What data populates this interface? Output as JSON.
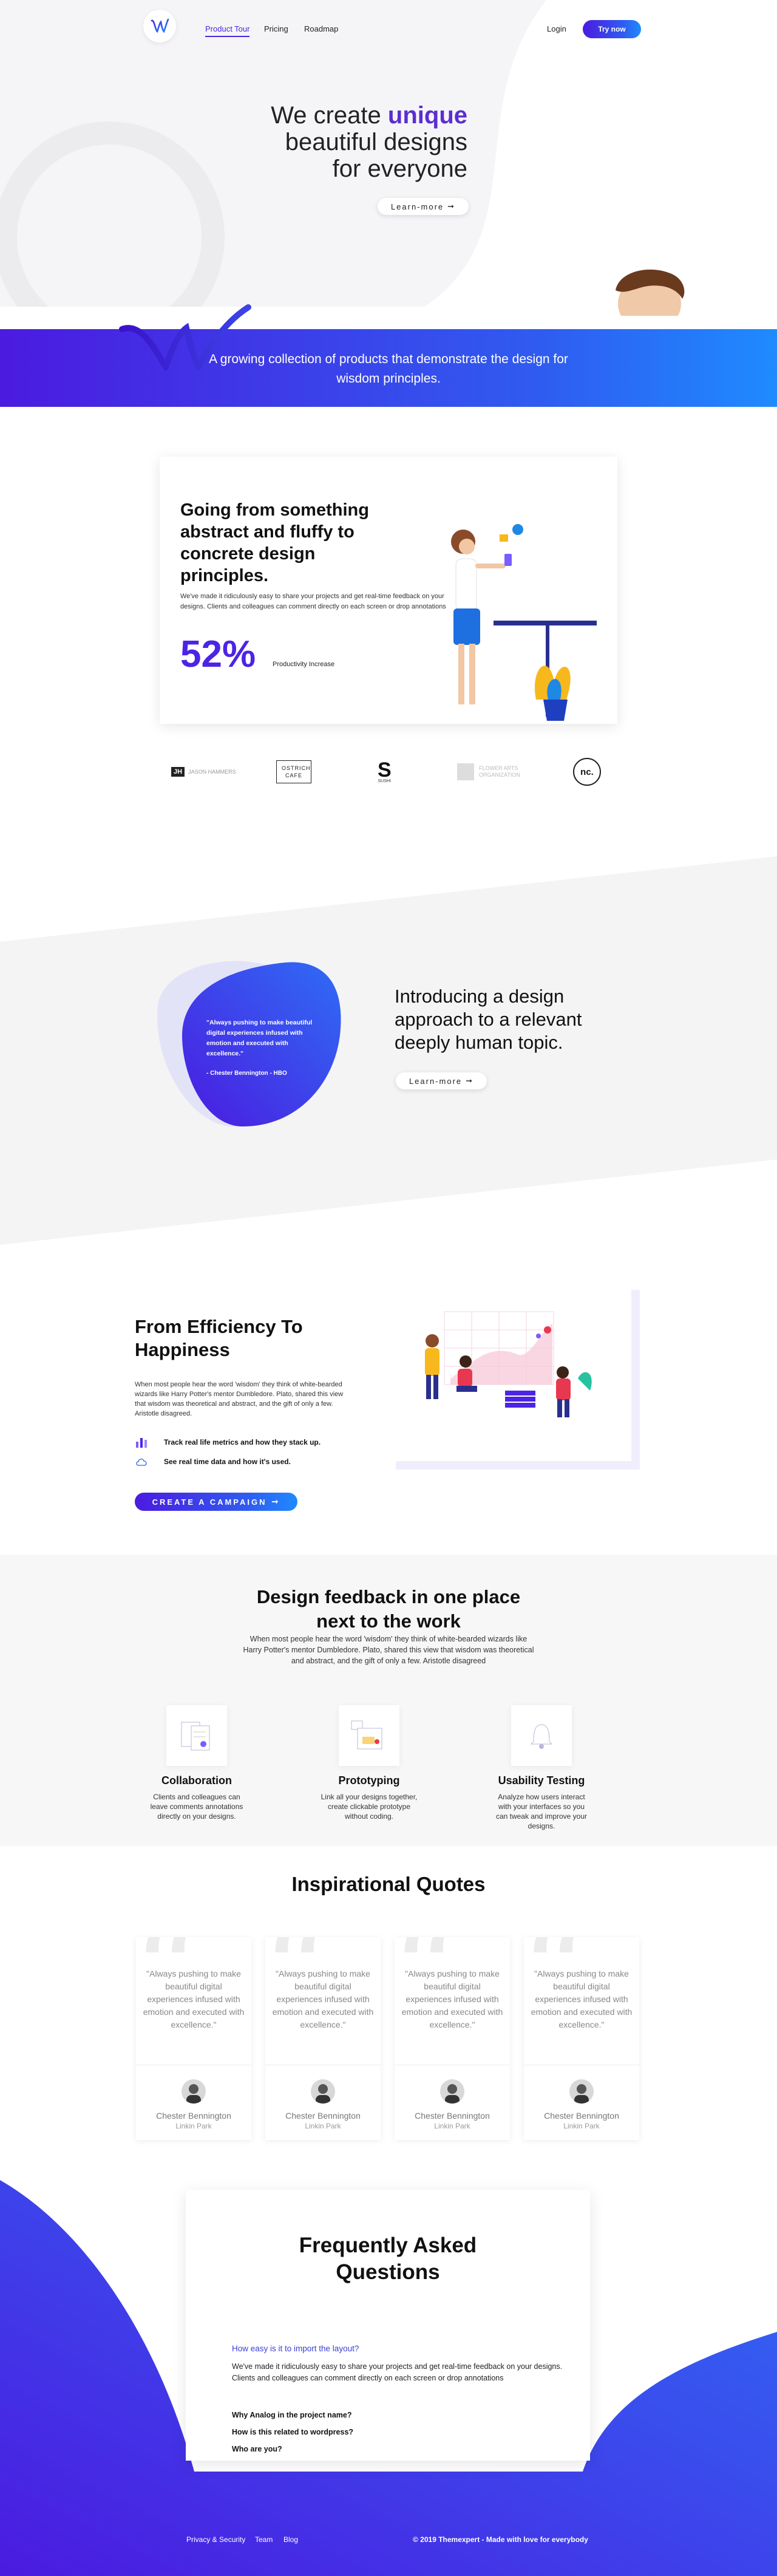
{
  "header": {
    "nav": [
      {
        "label": "Product Tour"
      },
      {
        "label": "Pricing"
      },
      {
        "label": "Roadmap"
      }
    ],
    "login": "Login",
    "cta": "Try now"
  },
  "hero": {
    "line1a": "We create",
    "line1b": "unique",
    "line2": "beautiful designs",
    "line3": "for everyone",
    "button": "Learn-more"
  },
  "banner": {
    "text": "A growing collection of products that demonstrate the design for wisdom principles."
  },
  "card1": {
    "title": "Going from something abstract and fluffy to concrete design principles.",
    "body": "We've made it ridiculously easy to share your projects and get real-time feedback on your designs. Clients and colleagues can comment directly on each screen or drop annotations",
    "stat": "52%",
    "stat_label": "Productivity Increase"
  },
  "logos": [
    {
      "text": "JASON HAMMERS"
    },
    {
      "text": "OSTRICH CAFE"
    },
    {
      "text": "SUSHI"
    },
    {
      "text": "FLOWER ARTS ORGANIZATION"
    },
    {
      "text": "nc."
    }
  ],
  "intro": {
    "quote": "\"Always pushing to make beautiful digital experiences infused with emotion and executed with excellence.\"",
    "author": "- Chester Bennington - HBO",
    "title": "Introducing a design approach to a relevant deeply human topic.",
    "button": "Learn-more"
  },
  "efficiency": {
    "title": "From Efficiency To Happiness",
    "body": "When most people hear the word 'wisdom' they think of white-bearded wizards like Harry Potter's mentor Dumbledore. Plato, shared this view that wisdom was theoretical and abstract, and the gift of only a few. Aristotle disagreed.",
    "features": [
      {
        "label": "Track real life metrics and how they stack up."
      },
      {
        "label": "See real time data and how it's used."
      }
    ],
    "cta": "CREATE A CAMPAIGN"
  },
  "feedback": {
    "title": "Design feedback in one place next to the work",
    "body": "When most people hear the word 'wisdom' they think of white-bearded wizards like Harry Potter's mentor Dumbledore. Plato, shared this view that wisdom was theoretical and abstract, and the gift of only a few. Aristotle disagreed",
    "cards": [
      {
        "title": "Collaboration",
        "text": "Clients and colleagues can leave comments annotations directly on your designs."
      },
      {
        "title": "Prototyping",
        "text": "Link all your designs together, create clickable prototype without coding."
      },
      {
        "title": "Usability Testing",
        "text": "Analyze how users interact with your interfaces so you can tweak and improve your designs."
      }
    ]
  },
  "quotes": {
    "title": "Inspirational Quotes",
    "items": [
      {
        "text": "\"Always pushing to make beautiful digital experiences infused with emotion and executed with excellence.\"",
        "name": "Chester Bennington",
        "band": "Linkin Park"
      },
      {
        "text": "\"Always pushing to make beautiful digital experiences infused with emotion and executed with excellence.\"",
        "name": "Chester Bennington",
        "band": "Linkin Park"
      },
      {
        "text": "\"Always pushing to make beautiful digital experiences infused with emotion and executed with excellence.\"",
        "name": "Chester Bennington",
        "band": "Linkin Park"
      },
      {
        "text": "\"Always pushing to make beautiful digital experiences infused with emotion and executed with excellence.\"",
        "name": "Chester Bennington",
        "band": "Linkin Park"
      }
    ]
  },
  "faq": {
    "title": "Frequently Asked Questions",
    "open_question": "How easy is it to import the layout?",
    "open_answer": "We've made it ridiculously easy to share your projects and get real-time feedback on your designs. Clients and colleagues can comment directly on each screen or drop annotations",
    "questions": [
      {
        "label": "Why Analog in the project name?"
      },
      {
        "label": "How is this related to wordpress?"
      },
      {
        "label": "Who are you?"
      }
    ]
  },
  "footer": {
    "links": [
      {
        "label": "Privacy & Security"
      },
      {
        "label": "Team"
      },
      {
        "label": "Blog"
      }
    ],
    "copyright": "© 2019 Themexpert - Made with love for everybody"
  },
  "colors": {
    "primary": "#4c24e6",
    "accent_blue": "#1f8bff",
    "text": "#111111"
  }
}
